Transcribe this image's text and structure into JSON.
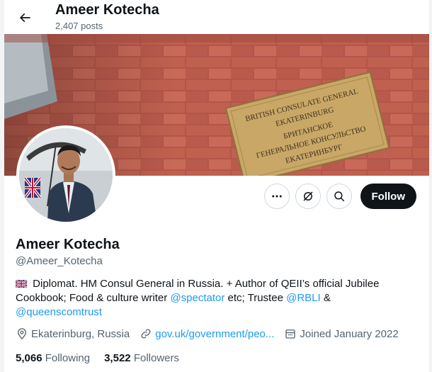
{
  "header": {
    "name": "Ameer Kotecha",
    "posts": "2,407 posts"
  },
  "banner": {
    "plaque_lines": [
      "BRITISH CONSULATE GENERAL",
      "EKATERINBURG",
      "БРИТАНСКОЕ",
      "ГЕНЕРАЛЬНОЕ КОНСУЛЬСТВО",
      "ЕКАТЕРИНБУРГ"
    ]
  },
  "actions": {
    "follow_label": "Follow"
  },
  "profile": {
    "display_name": "Ameer Kotecha",
    "handle": "@Ameer_Kotecha",
    "bio_part1": " Diplomat. HM Consul General in Russia. + Author of QEII’s official Jubilee Cookbook; Food & culture writer ",
    "bio_link1": "@spectator",
    "bio_part2": " etc; Trustee ",
    "bio_link2": "@RBLI",
    "bio_part3": " & ",
    "bio_link3": "@queenscomtrust"
  },
  "meta": {
    "location": "Ekaterinburg, Russia",
    "website": "gov.uk/government/peo...",
    "joined": "Joined January 2022"
  },
  "stats": {
    "following_count": "5,066",
    "following_label": "Following",
    "followers_count": "3,522",
    "followers_label": "Followers"
  },
  "colors": {
    "accent": "#1d9bf0",
    "text": "#0f1419",
    "muted": "#536471"
  }
}
